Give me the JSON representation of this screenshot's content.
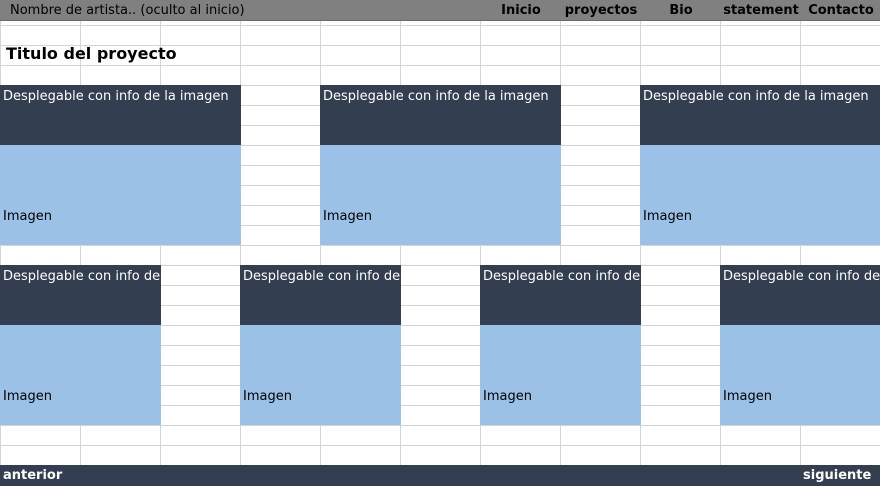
{
  "header": {
    "artist_name": "Nombre de artista.. (oculto al inicio)",
    "nav": [
      "Inicio",
      "proyectos",
      "Bio",
      "statement",
      "Contacto"
    ]
  },
  "project": {
    "title": "Titulo del proyecto"
  },
  "cards": {
    "dropdown_label": "Desplegable con info de la imagen",
    "image_label": "Imagen"
  },
  "footer": {
    "prev_label": "anterior",
    "next_label": "siguiente"
  },
  "colors": {
    "header_bg": "#808080",
    "dropdown_bg": "#333f50",
    "image_bg": "#9bc2e6",
    "footer_bg": "#333f50"
  }
}
